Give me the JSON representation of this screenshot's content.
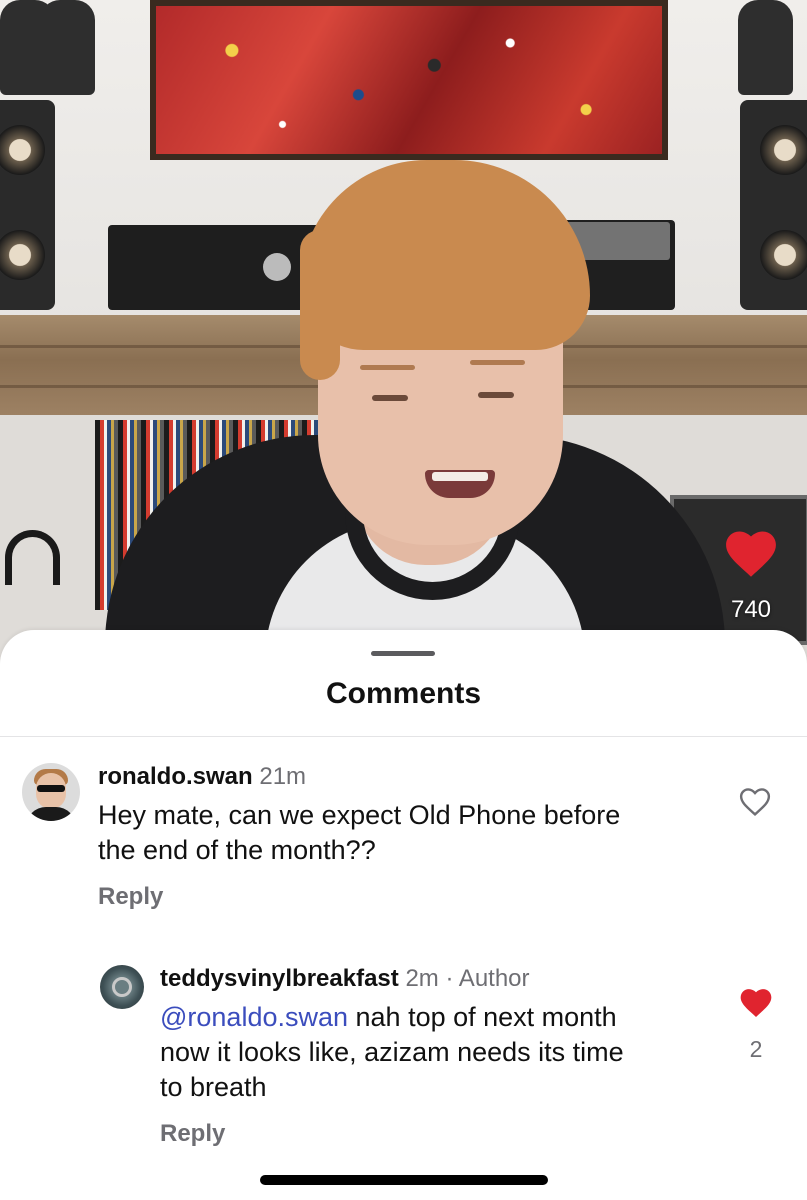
{
  "live": {
    "like_count": "740",
    "like_color": "#e0242f"
  },
  "sheet": {
    "title": "Comments"
  },
  "comments": [
    {
      "username": "ronaldo.swan",
      "time": "21m",
      "text_lines": [
        "Hey mate, can we expect Old Phone before",
        "the end of the month??"
      ],
      "reply_label": "Reply",
      "liked": false,
      "avatar": "avatar-suit-sunglasses"
    },
    {
      "username": "teddysvinylbreakfast",
      "time": "2m",
      "author_label": "· Author",
      "mention": "@ronaldo.swan",
      "text_first": " nah top of next month",
      "text_lines": [
        "now it looks like, azizam needs its time",
        "to breath"
      ],
      "reply_label": "Reply",
      "liked": true,
      "like_count": "2",
      "avatar": "avatar-vinyl"
    }
  ],
  "colors": {
    "mention": "#3b4dbd",
    "liked_heart": "#e0242f",
    "muted_text": "#6e6e73"
  }
}
